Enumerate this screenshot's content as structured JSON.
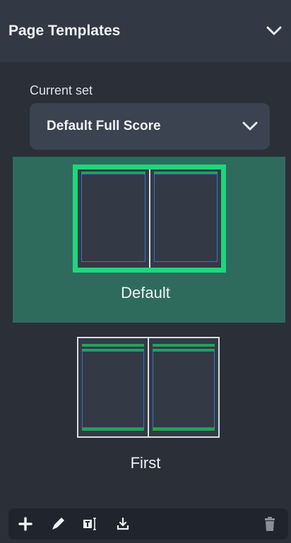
{
  "panel": {
    "title": "Page Templates",
    "collapse_icon": "chevron-down-icon"
  },
  "current_set": {
    "label": "Current set",
    "value": "Default Full Score"
  },
  "templates": [
    {
      "label": "Default",
      "selected": true
    },
    {
      "label": "First",
      "selected": false
    }
  ],
  "toolbar": {
    "icons": [
      "add-icon",
      "edit-pencil-icon",
      "rename-text-icon",
      "import-icon",
      "delete-trash-icon"
    ]
  },
  "colors": {
    "accent": "#1fd67a",
    "selected_bg": "#2f6b5d",
    "panel_bg": "#2a2f38",
    "header_bg": "#323844"
  }
}
